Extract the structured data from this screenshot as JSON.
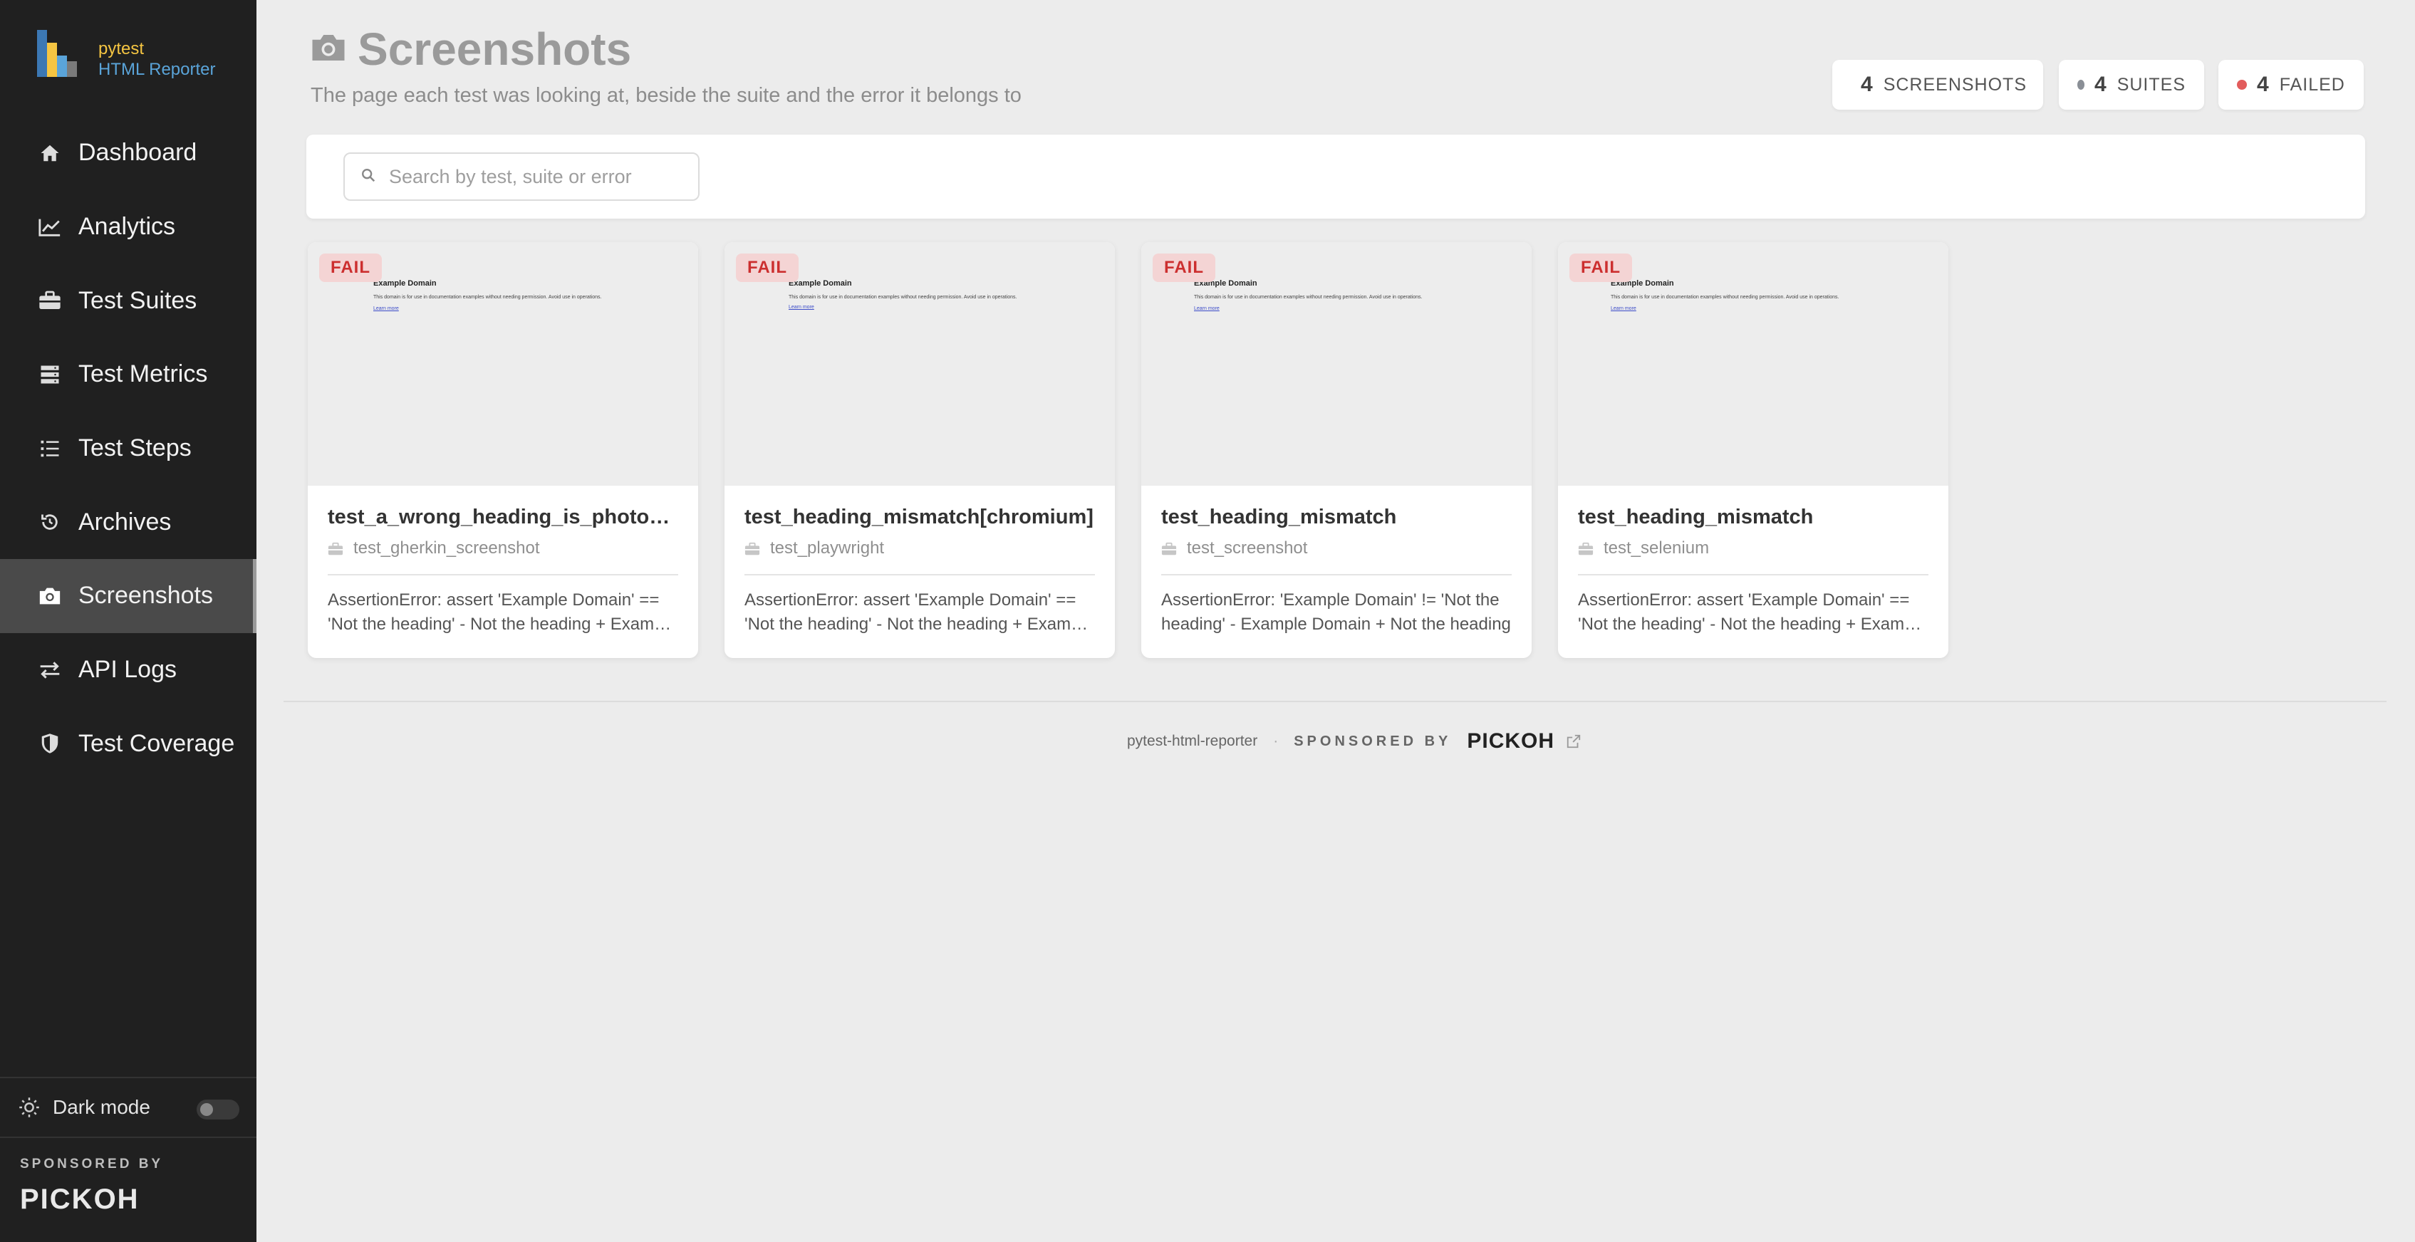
{
  "brand": {
    "name": "pytest",
    "subtitle": "HTML Reporter"
  },
  "sidebar": {
    "items": [
      {
        "label": "Dashboard",
        "icon": "home-icon"
      },
      {
        "label": "Analytics",
        "icon": "chart-line-icon"
      },
      {
        "label": "Test Suites",
        "icon": "briefcase-icon"
      },
      {
        "label": "Test Metrics",
        "icon": "server-icon"
      },
      {
        "label": "Test Steps",
        "icon": "list-icon"
      },
      {
        "label": "Archives",
        "icon": "history-icon"
      },
      {
        "label": "Screenshots",
        "icon": "camera-icon",
        "active": true
      },
      {
        "label": "API Logs",
        "icon": "exchange-icon"
      },
      {
        "label": "Test Coverage",
        "icon": "shield-icon"
      }
    ],
    "dark_mode_label": "Dark mode",
    "sponsored_by": "SPONSORED BY",
    "sponsor_logo": "PICKOH"
  },
  "header": {
    "title": "Screenshots",
    "subtitle": "The page each test was looking at, beside the suite and the error it belongs to"
  },
  "stats": [
    {
      "count": "4",
      "label": "SCREENSHOTS",
      "color": "#444444"
    },
    {
      "count": "4",
      "label": "SUITES",
      "color": "#8a8f96"
    },
    {
      "count": "4",
      "label": "FAILED",
      "color": "#e25c5c"
    }
  ],
  "search": {
    "placeholder": "Search by test, suite or error",
    "value": ""
  },
  "cards": [
    {
      "status": "FAIL",
      "title": "test_a_wrong_heading_is_photographed",
      "suite": "test_gherkin_screenshot",
      "error": "AssertionError: assert 'Example Domain' == 'Not the heading' - Not the heading + Example Domain"
    },
    {
      "status": "FAIL",
      "title": "test_heading_mismatch[chromium]",
      "suite": "test_playwright",
      "error": "AssertionError: assert 'Example Domain' == 'Not the heading' - Not the heading + Example Domain"
    },
    {
      "status": "FAIL",
      "title": "test_heading_mismatch",
      "suite": "test_screenshot",
      "error": "AssertionError: 'Example Domain' != 'Not the heading' - Example Domain + Not the heading"
    },
    {
      "status": "FAIL",
      "title": "test_heading_mismatch",
      "suite": "test_selenium",
      "error": "AssertionError: assert 'Example Domain' == 'Not the heading' - Not the heading + Example Domain"
    }
  ],
  "thumbnail": {
    "heading": "Example Domain",
    "text": "This domain is for use in documentation examples without needing permission. Avoid use in operations.",
    "link": "Learn more"
  },
  "footer": {
    "project": "pytest-html-reporter",
    "separator": "·",
    "sponsored_by": "SPONSORED BY",
    "sponsor_logo": "PICKOH"
  },
  "colors": {
    "sidebar_bg": "#202020",
    "page_bg": "#ececec",
    "fail_badge_bg": "#f4d4d4",
    "fail_badge_text": "#cc2f2f",
    "brand_yellow": "#f5c542",
    "brand_blue": "#5aa4d9"
  }
}
